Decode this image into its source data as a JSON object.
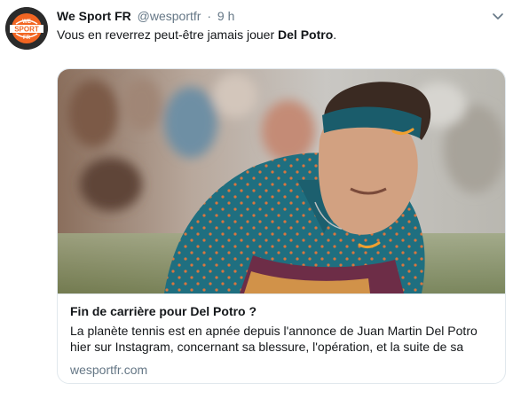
{
  "tweet": {
    "display_name": "We Sport FR",
    "handle": "@wesportfr",
    "separator": "·",
    "time": "9 h",
    "text_before": "Vous en reverrez peut-être jamais jouer ",
    "text_bold": "Del Potro",
    "text_after": ".",
    "avatar_logo": {
      "line1": "WE",
      "line2": "SPORT",
      "line3": "FR"
    }
  },
  "card": {
    "title": "Fin de carrière pour Del Potro ?",
    "description": "La planète tennis est en apnée depuis l'annonce de Juan Martin Del Potro hier sur Instagram, concernant sa blessure, l'opération, et la suite de sa",
    "domain": "wesportfr.com"
  },
  "colors": {
    "text_primary": "#14171a",
    "text_secondary": "#657786",
    "border": "#e1e8ed",
    "logo_orange": "#f26522",
    "shirt_teal": "#1f6f80",
    "headband": "#1a5c6b"
  },
  "icons": {
    "caret": "chevron-down-icon"
  }
}
